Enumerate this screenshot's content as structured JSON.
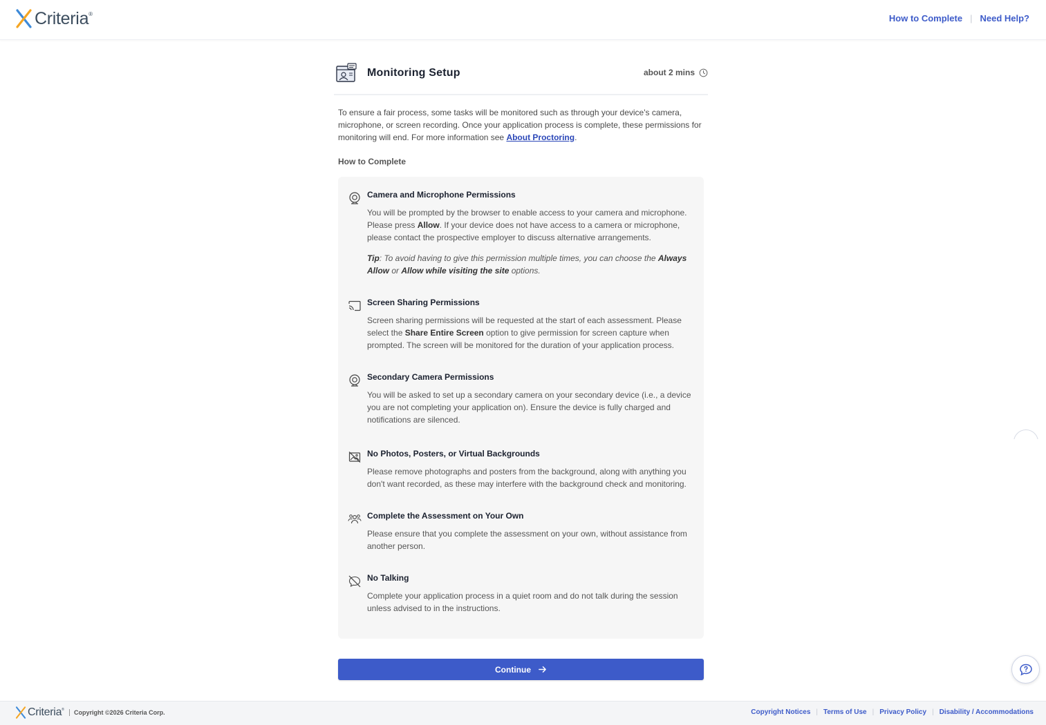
{
  "header": {
    "brand": "Criteria",
    "trademark": "®",
    "links": [
      "How to Complete",
      "Need Help?"
    ]
  },
  "section": {
    "title": "Monitoring Setup",
    "duration": "about 2 mins",
    "intro_text": "To ensure a fair process, some tasks will be monitored such as through your device's camera, microphone, or screen recording. Once your application process is complete, these permissions for monitoring will end. For more information see ",
    "intro_link": "About Proctoring",
    "intro_end": ".",
    "how_to_heading": "How to Complete"
  },
  "items": [
    {
      "icon": "webcam-icon",
      "title": "Camera and Microphone Permissions",
      "desc_parts": [
        "You will be prompted by the browser to enable access to your camera and microphone. Please press ",
        "Allow",
        ". If your device does not have access to a camera or microphone, please contact the prospective employer to discuss alternative arrangements."
      ],
      "tip_parts": [
        "Tip",
        ": To avoid having to give this permission multiple times, you can choose the ",
        "Always Allow",
        " or ",
        "Allow while visiting the site",
        " options."
      ]
    },
    {
      "icon": "screen-cast-icon",
      "title": "Screen Sharing Permissions",
      "desc_parts": [
        "Screen sharing permissions will be requested at the start of each assessment. Please select the ",
        "Share Entire Screen",
        " option to give permission for screen capture when prompted. The screen will be monitored for the duration of your application process."
      ]
    },
    {
      "icon": "webcam-icon",
      "title": "Secondary Camera Permissions",
      "desc_parts": [
        "You will be asked to set up a secondary camera on your secondary device (i.e., a device you are not completing your application on). Ensure the device is fully charged and notifications are silenced."
      ]
    },
    {
      "icon": "no-image-icon",
      "title": "No Photos, Posters, or Virtual Backgrounds",
      "desc_parts": [
        "Please remove photographs and posters from the background, along with anything you don't want recorded, as these may interfere with the background check and monitoring."
      ]
    },
    {
      "icon": "people-icon",
      "title": "Complete the Assessment on Your Own",
      "desc_parts": [
        "Please ensure that you complete the assessment on your own, without assistance from another person."
      ]
    },
    {
      "icon": "no-talking-icon",
      "title": "No Talking",
      "desc_parts": [
        "Complete your application process in a quiet room and do not talk during the session unless advised to in the instructions."
      ]
    }
  ],
  "continue_label": "Continue",
  "footer": {
    "brand": "Criteria",
    "copyright": "Copyright ©2026 Criteria Corp.",
    "links": [
      "Copyright Notices",
      "Terms of Use",
      "Privacy Policy",
      "Disability / Accommodations"
    ]
  },
  "colors": {
    "accent": "#3d5bc9",
    "logo_orange": "#f5a623",
    "logo_blue": "#3d8ad9"
  }
}
